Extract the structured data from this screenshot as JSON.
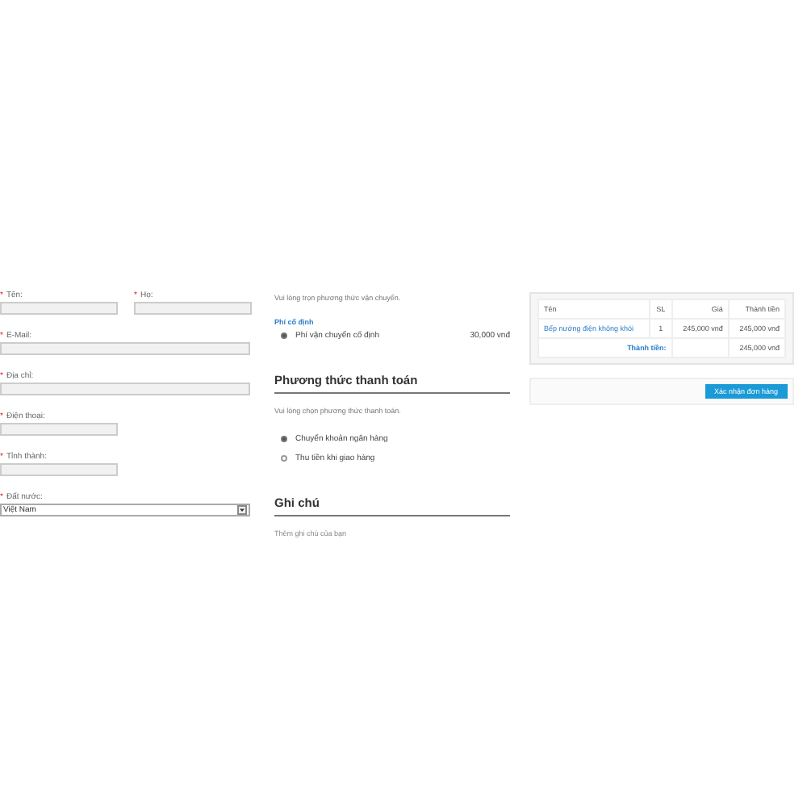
{
  "customer_form": {
    "fields": [
      {
        "required_mark": "*",
        "label": "Tên:",
        "kind": "short"
      },
      {
        "required_mark": "*",
        "label": "Họ:",
        "kind": "short"
      },
      {
        "required_mark": "*",
        "label": "E-Mail:",
        "kind": "wide"
      },
      {
        "required_mark": "*",
        "label": "Địa chỉ:",
        "kind": "wide"
      },
      {
        "required_mark": "*",
        "label": "Điện thoại:",
        "kind": "short"
      },
      {
        "required_mark": "*",
        "label": "Tỉnh thành:",
        "kind": "short"
      },
      {
        "required_mark": "*",
        "label": "Đất nước:",
        "kind": "select",
        "value": "Việt Nam"
      }
    ]
  },
  "shipping": {
    "hint": "Vui lòng trọn phương thức vận chuyển.",
    "group": "Phí cố định",
    "options": [
      {
        "label": "Phí vận chuyển cố định",
        "price": "30,000 vnđ",
        "selected": true
      }
    ]
  },
  "payment": {
    "title": "Phương thức thanh toán",
    "hint": "Vui lòng chọn phương thức thanh toán.",
    "options": [
      {
        "label": "Chuyển khoản ngân hàng",
        "selected": true
      },
      {
        "label": "Thu tiền khi giao hàng",
        "selected": false
      }
    ]
  },
  "note": {
    "title": "Ghi chú",
    "placeholder": "Thêm ghi chú của bạn"
  },
  "cart": {
    "columns": [
      "Tên",
      "SL",
      "Giá",
      "Thành tiền"
    ],
    "rows": [
      {
        "name": "Bếp nướng điện không khói",
        "qty": "1",
        "price": "245,000 vnđ",
        "total": "245,000 vnđ"
      }
    ],
    "total_label": "Thành tiền:",
    "total": "245,000 vnđ"
  },
  "confirm_button": "Xác nhận đơn hàng"
}
